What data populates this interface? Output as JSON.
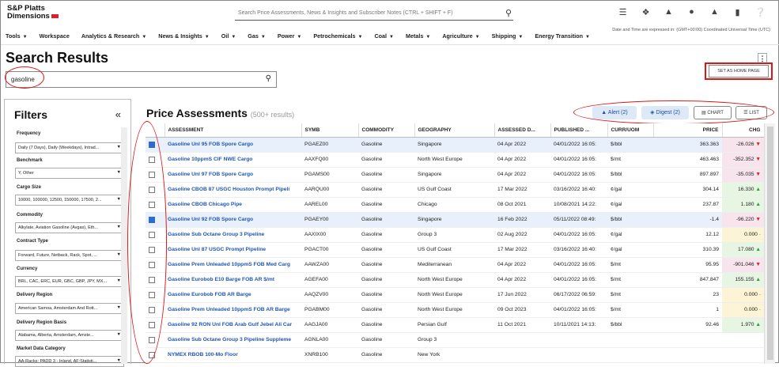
{
  "app": {
    "name_line1": "S&P Platts",
    "name_line2": "Dimensions"
  },
  "top_search": {
    "placeholder": "Search Price Assessments, News & Insights and Subscriber Notes (CTRL + SHIFT + F)"
  },
  "top_icons": [
    "list-icon",
    "broadcast-icon",
    "bell-icon",
    "user-icon",
    "notification-icon",
    "bookmark-icon",
    "help-icon"
  ],
  "nav": [
    "Tools",
    "Workspace",
    "Analytics & Research",
    "News & Insights",
    "Oil",
    "Gas",
    "Power",
    "Petrochemicals",
    "Coal",
    "Metals",
    "Agriculture",
    "Shipping",
    "Energy Transition"
  ],
  "timezone_note": "Date and Time are expressed in: (GMT+00:00) Coordinated Universal Time (UTC)",
  "page_title": "Search Results",
  "search_value": "gasoline",
  "set_home": "SET AS HOME PAGE",
  "filters": {
    "title": "Filters",
    "collapse": "«",
    "items": [
      {
        "label": "Frequency",
        "value": "Daily (7 Days), Daily (Weekdays), Intrad..."
      },
      {
        "label": "Benchmark",
        "value": "Y, Other"
      },
      {
        "label": "Cargo Size",
        "value": "10000, 100000, 12500, 150000, 17500, 2..."
      },
      {
        "label": "Commodity",
        "value": "Alkylate, Aviation Gasoline (Avgas), Eth..."
      },
      {
        "label": "Contract Type",
        "value": "Forward, Future, Netback, Rack, Spot, ..."
      },
      {
        "label": "Currency",
        "value": "BRL, CAC, ERC, EUR, GBC, GBP, JPY, MX..."
      },
      {
        "label": "Delivery Region",
        "value": "American Samoa, Amsterdam And Rott..."
      },
      {
        "label": "Delivery Region Basis",
        "value": "Alabama, Alberta, Amsterdam, Amste..."
      },
      {
        "label": "Market Data Category",
        "value": "AA-Racks: PADD 3 - Inland, AF:Statisti..."
      }
    ]
  },
  "results": {
    "title": "Price Assessments",
    "count": "(500+ results)",
    "alert": "Alert (2)",
    "digest": "Digest (2)",
    "chart": "CHART",
    "list": "LIST"
  },
  "columns": [
    "ASSESSMENT",
    "SYMB",
    "COMMODITY",
    "GEOGRAPHY",
    "ASSESSED D...",
    "PUBLISHED ...",
    "CURR/UOM",
    "PRICE",
    "CHG"
  ],
  "rows": [
    {
      "checked": true,
      "name": "Gasoline Unl 95 FOB Spore Cargo",
      "symb": "PGAEZ00",
      "commodity": "Gasoline",
      "geo": "Singapore",
      "assessed": "04 Apr 2022",
      "published": "04/01/2022 16:05:",
      "uom": "$/bbl",
      "price": "363.363",
      "chg": "-26.026",
      "dir": "down"
    },
    {
      "checked": false,
      "name": "Gasoline 10ppmS CIF NWE Cargo",
      "symb": "AAXFQ00",
      "commodity": "Gasoline",
      "geo": "North West Europe",
      "assessed": "04 Apr 2022",
      "published": "04/01/2022 16:05:",
      "uom": "$/mt",
      "price": "463.463",
      "chg": "-352.352",
      "dir": "down"
    },
    {
      "checked": false,
      "name": "Gasoline Unl 97 FOB Spore Cargo",
      "symb": "PGAMS00",
      "commodity": "Gasoline",
      "geo": "Singapore",
      "assessed": "04 Apr 2022",
      "published": "04/01/2022 16:05:",
      "uom": "$/bbl",
      "price": "897.897",
      "chg": "-35.035",
      "dir": "down"
    },
    {
      "checked": false,
      "name": "Gasoline CBOB 87 USGC Houston Prompt Pipeli",
      "symb": "AARQU00",
      "commodity": "Gasoline",
      "geo": "US Gulf Coast",
      "assessed": "17 Mar 2022",
      "published": "03/16/2022 16:40:",
      "uom": "¢/gal",
      "price": "304.14",
      "chg": "16.330",
      "dir": "up"
    },
    {
      "checked": false,
      "name": "Gasoline CBOB Chicago Pipe",
      "symb": "AAREL00",
      "commodity": "Gasoline",
      "geo": "Chicago",
      "assessed": "08 Oct 2021",
      "published": "10/08/2021 14:22:",
      "uom": "¢/gal",
      "price": "237.87",
      "chg": "1.180",
      "dir": "up"
    },
    {
      "checked": true,
      "name": "Gasoline Unl 92 FOB Spore Cargo",
      "symb": "PGAEY00",
      "commodity": "Gasoline",
      "geo": "Singapore",
      "assessed": "16 Feb 2022",
      "published": "05/11/2022 08:49:",
      "uom": "$/bbl",
      "price": "-1.4",
      "chg": "-96.220",
      "dir": "down"
    },
    {
      "checked": false,
      "name": "Gasoline Sub Octane Group 3 Pipeline",
      "symb": "AAXIX00",
      "commodity": "Gasoline",
      "geo": "Group 3",
      "assessed": "02 Aug 2022",
      "published": "04/01/2022 16:05:",
      "uom": "¢/gal",
      "price": "12.12",
      "chg": "0.000",
      "dir": "flat"
    },
    {
      "checked": false,
      "name": "Gasoline Unl 87 USGC Prompt Pipeline",
      "symb": "PGACT00",
      "commodity": "Gasoline",
      "geo": "US Gulf Coast",
      "assessed": "17 Mar 2022",
      "published": "03/16/2022 16:40:",
      "uom": "¢/gal",
      "price": "310.39",
      "chg": "17.080",
      "dir": "up"
    },
    {
      "checked": false,
      "name": "Gasoline Prem Unleaded 10ppmS FOB Med Carg",
      "symb": "AAWZA00",
      "commodity": "Gasoline",
      "geo": "Mediterranean",
      "assessed": "04 Apr 2022",
      "published": "04/01/2022 16:05:",
      "uom": "$/mt",
      "price": "95.95",
      "chg": "-901.046",
      "dir": "down"
    },
    {
      "checked": false,
      "name": "Gasoline Eurobob E10 Barge FOB AR $/mt",
      "symb": "AGEFA00",
      "commodity": "Gasoline",
      "geo": "North West Europe",
      "assessed": "04 Apr 2022",
      "published": "04/01/2022 16:05:",
      "uom": "$/mt",
      "price": "847.847",
      "chg": "155.155",
      "dir": "up"
    },
    {
      "checked": false,
      "name": "Gasoline Eurobob FOB AR Barge",
      "symb": "AAQZV00",
      "commodity": "Gasoline",
      "geo": "North West Europe",
      "assessed": "17 Jun 2022",
      "published": "06/17/2022 06:59:",
      "uom": "$/mt",
      "price": "23",
      "chg": "0.000",
      "dir": "flat"
    },
    {
      "checked": false,
      "name": "Gasoline Prem Unleaded 10ppmS FOB AR Barge",
      "symb": "PGABM00",
      "commodity": "Gasoline",
      "geo": "North West Europe",
      "assessed": "09 Oct 2023",
      "published": "04/01/2022 16:05:",
      "uom": "$/mt",
      "price": "1",
      "chg": "0.000",
      "dir": "flat"
    },
    {
      "checked": false,
      "name": "Gasoline 92 RON Unl FOB Arab Gulf Jebel Ali Car",
      "symb": "AAGJA00",
      "commodity": "Gasoline",
      "geo": "Persian Gulf",
      "assessed": "11 Oct 2021",
      "published": "10/11/2021 14:13:",
      "uom": "$/bbl",
      "price": "92.46",
      "chg": "1.970",
      "dir": "up"
    },
    {
      "checked": false,
      "name": "Gasoline Sub Octane Group 3 Pipeline Suppleme",
      "symb": "AGNLA00",
      "commodity": "Gasoline",
      "geo": "Group 3",
      "assessed": "",
      "published": "",
      "uom": "",
      "price": "",
      "chg": "",
      "dir": ""
    },
    {
      "checked": false,
      "name": "NYMEX RBOB 100-Mo Floor",
      "symb": "XNRB100",
      "commodity": "Gasoline",
      "geo": "New York",
      "assessed": "",
      "published": "",
      "uom": "",
      "price": "",
      "chg": "",
      "dir": ""
    }
  ],
  "colors": {
    "link": "#1f56b5",
    "up": "#2a9a3a",
    "down": "#cc2222",
    "annotation": "#e01616",
    "selected_row": "#e8f0fb"
  }
}
